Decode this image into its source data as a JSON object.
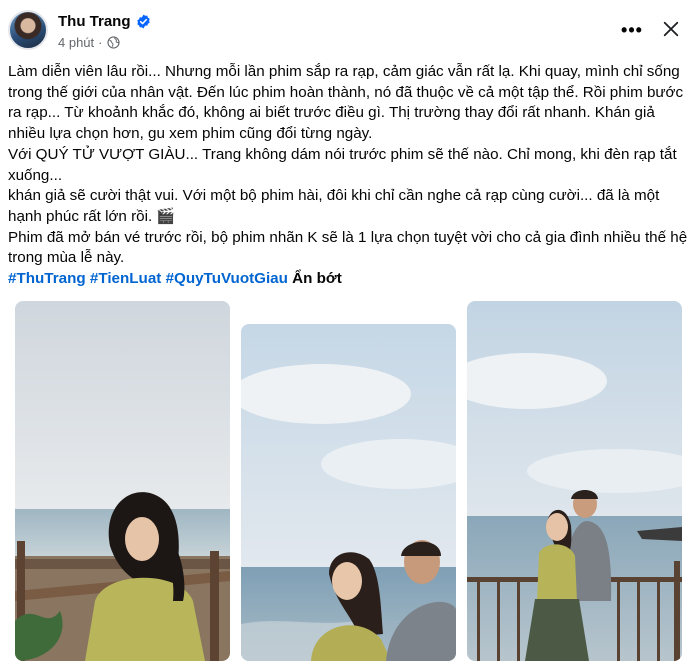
{
  "post": {
    "author": "Thu Trang",
    "timestamp": "4 phút",
    "more_label": "•••",
    "paragraphs": [
      "Làm diễn viên lâu rồi... Nhưng mỗi lần phim sắp ra rạp, cảm giác vẫn rất lạ. Khi quay, mình chỉ sống trong thế giới của nhân vật. Đến lúc phim hoàn thành, nó đã thuộc về cả một tập thể. Rồi phim bước ra rạp... Từ khoảnh khắc đó, không ai biết trước điều gì. Thị trường thay đổi rất nhanh. Khán giả nhiều lựa chọn hơn, gu xem phim cũng đổi từng ngày.",
      "Với QUÝ TỬ VƯỢT GIÀU... Trang không dám nói trước phim sẽ thế nào. Chỉ mong, khi đèn rạp tắt xuống...",
      "khán giả sẽ cười thật vui. Với một bộ phim hài, đôi khi chỉ cần nghe cả rạp cùng cười... đã là một hạnh phúc rất lớn rồi. 🎬",
      "Phim đã mở bán vé trước rồi, bộ phim nhãn K sẽ là 1 lựa chọn tuyệt vời cho cả gia đình nhiều thế hệ trong mùa lễ này."
    ],
    "hashtags": [
      "#ThuTrang",
      "#TienLuat",
      "#QuyTuVuotGiau"
    ],
    "see_less": "Ẩn bớt"
  },
  "icons": {
    "verified": "verified-badge-icon",
    "privacy": "globe-icon",
    "close": "close-icon"
  },
  "colors": {
    "link": "#0064d1",
    "verified": "#0866ff",
    "secondary_text": "#65676b"
  }
}
